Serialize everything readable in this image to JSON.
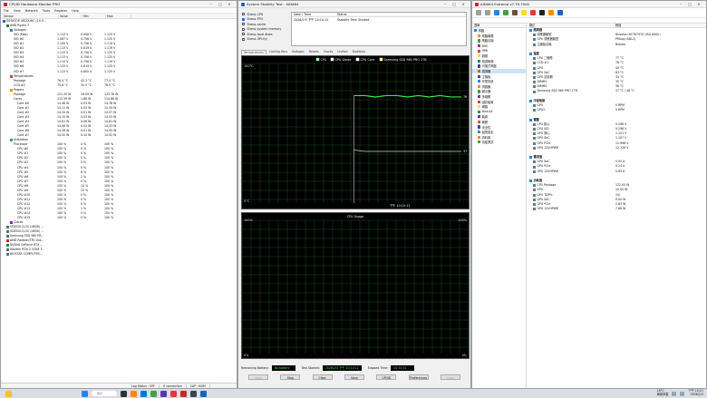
{
  "hwmonitor": {
    "title": "CPUID Hardware Monitor PRO",
    "menu": [
      "File",
      "View",
      "Network",
      "Tools",
      "Register",
      "Help"
    ],
    "columns": [
      "Sensor",
      "Value",
      "Min",
      "Max"
    ],
    "rows": [
      {
        "indent": 0,
        "label": "DESKTOP-4RCDUHC (10.0...",
        "v": "",
        "mn": "",
        "mx": "",
        "icon": "#2b6cb0"
      },
      {
        "indent": 1,
        "label": "AMD Ryzen 7",
        "v": "",
        "mn": "",
        "mx": "",
        "icon": "#2e7d32"
      },
      {
        "indent": 2,
        "label": "Voltages",
        "v": "",
        "mn": "",
        "mx": "",
        "icon": "#1e88e5"
      },
      {
        "indent": 3,
        "label": "VID (Max)",
        "v": "1.113 V",
        "mn": "0.956 V",
        "mx": "1.125 V",
        "icon": ""
      },
      {
        "indent": 3,
        "label": "VID #0",
        "v": "1.087 V",
        "mn": "0.756 V",
        "mx": "1.125 V",
        "icon": ""
      },
      {
        "indent": 3,
        "label": "VID #1",
        "v": "1.100 V",
        "mn": "0.756 V",
        "mx": "1.119 V",
        "icon": ""
      },
      {
        "indent": 3,
        "label": "VID #2",
        "v": "1.113 V",
        "mn": "0.819 V",
        "mx": "1.119 V",
        "icon": ""
      },
      {
        "indent": 3,
        "label": "VID #3",
        "v": "1.113 V",
        "mn": "0.756 V",
        "mx": "1.125 V",
        "icon": ""
      },
      {
        "indent": 3,
        "label": "VID #4",
        "v": "1.113 V",
        "mn": "0.756 V",
        "mx": "1.125 V",
        "icon": ""
      },
      {
        "indent": 3,
        "label": "VID #5",
        "v": "1.113 V",
        "mn": "0.756 V",
        "mx": "1.119 V",
        "icon": ""
      },
      {
        "indent": 3,
        "label": "VID #6",
        "v": "1.125 V",
        "mn": "0.819 V",
        "mx": "1.125 V",
        "icon": ""
      },
      {
        "indent": 3,
        "label": "VID #7",
        "v": "1.113 V",
        "mn": "0.800 V",
        "mx": "1.125 V",
        "icon": ""
      },
      {
        "indent": 2,
        "label": "Temperatures",
        "v": "",
        "mn": "",
        "mx": "",
        "icon": "#e53935"
      },
      {
        "indent": 3,
        "label": "Package",
        "v": "76.4 °C",
        "mn": "42.3 °C",
        "mx": "77.4 °C",
        "icon": ""
      },
      {
        "indent": 3,
        "label": "CCD #0",
        "v": "75.8 °C",
        "mn": "32.0 °C",
        "mx": "78.5 °C",
        "icon": ""
      },
      {
        "indent": 2,
        "label": "Powers",
        "v": "",
        "mn": "",
        "mx": "",
        "icon": "#fb8c00"
      },
      {
        "indent": 3,
        "label": "Package",
        "v": "121.20 W",
        "mn": "19.09 W",
        "mx": "123.78 W",
        "icon": ""
      },
      {
        "indent": 3,
        "label": "Cores",
        "v": "112.59 W",
        "mn": "1.68 W",
        "mx": "114.68 W",
        "icon": ""
      },
      {
        "indent": 4,
        "label": "Core #0",
        "v": "14.48 W",
        "mn": "0.03 W",
        "mx": "14.78 W",
        "icon": ""
      },
      {
        "indent": 4,
        "label": "Core #1",
        "v": "14.11 W",
        "mn": "0.02 W",
        "mx": "14.34 W",
        "icon": ""
      },
      {
        "indent": 4,
        "label": "Core #2",
        "v": "14.34 W",
        "mn": "0.01 W",
        "mx": "14.57 W",
        "icon": ""
      },
      {
        "indent": 4,
        "label": "Core #3",
        "v": "14.15 W",
        "mn": "0.03 W",
        "mx": "14.53 W",
        "icon": ""
      },
      {
        "indent": 4,
        "label": "Core #4",
        "v": "14.61 W",
        "mn": "0.06 W",
        "mx": "14.81 W",
        "icon": ""
      },
      {
        "indent": 4,
        "label": "Core #5",
        "v": "14.06 W",
        "mn": "0.02 W",
        "mx": "14.33 W",
        "icon": ""
      },
      {
        "indent": 4,
        "label": "Core #6",
        "v": "14.28 W",
        "mn": "0.01 W",
        "mx": "14.55 W",
        "icon": ""
      },
      {
        "indent": 4,
        "label": "Core #7",
        "v": "14.52 W",
        "mn": "0.10 W",
        "mx": "14.92 W",
        "icon": ""
      },
      {
        "indent": 2,
        "label": "Utilization",
        "v": "",
        "mn": "",
        "mx": "",
        "icon": "#43a047"
      },
      {
        "indent": 3,
        "label": "Processor",
        "v": "100 %",
        "mn": "4 %",
        "mx": "100 %",
        "icon": ""
      },
      {
        "indent": 4,
        "label": "CPU #0",
        "v": "100 %",
        "mn": "0 %",
        "mx": "100 %",
        "icon": ""
      },
      {
        "indent": 4,
        "label": "CPU #1",
        "v": "100 %",
        "mn": "0 %",
        "mx": "100 %",
        "icon": ""
      },
      {
        "indent": 4,
        "label": "CPU #2",
        "v": "100 %",
        "mn": "0 %",
        "mx": "100 %",
        "icon": ""
      },
      {
        "indent": 4,
        "label": "CPU #3",
        "v": "100 %",
        "mn": "0 %",
        "mx": "100 %",
        "icon": ""
      },
      {
        "indent": 4,
        "label": "CPU #4",
        "v": "100 %",
        "mn": "0 %",
        "mx": "100 %",
        "icon": ""
      },
      {
        "indent": 4,
        "label": "CPU #5",
        "v": "100 %",
        "mn": "6 %",
        "mx": "100 %",
        "icon": ""
      },
      {
        "indent": 4,
        "label": "CPU #6",
        "v": "100 %",
        "mn": "2 %",
        "mx": "100 %",
        "icon": ""
      },
      {
        "indent": 4,
        "label": "CPU #7",
        "v": "100 %",
        "mn": "0 %",
        "mx": "100 %",
        "icon": ""
      },
      {
        "indent": 4,
        "label": "CPU #8",
        "v": "100 %",
        "mn": "14 %",
        "mx": "100 %",
        "icon": ""
      },
      {
        "indent": 4,
        "label": "CPU #9",
        "v": "100 %",
        "mn": "15 %",
        "mx": "100 %",
        "icon": ""
      },
      {
        "indent": 4,
        "label": "CPU #10",
        "v": "100 %",
        "mn": "0 %",
        "mx": "100 %",
        "icon": ""
      },
      {
        "indent": 4,
        "label": "CPU #11",
        "v": "100 %",
        "mn": "0 %",
        "mx": "100 %",
        "icon": ""
      },
      {
        "indent": 4,
        "label": "CPU #12",
        "v": "100 %",
        "mn": "0 %",
        "mx": "100 %",
        "icon": ""
      },
      {
        "indent": 4,
        "label": "CPU #13",
        "v": "100 %",
        "mn": "1 %",
        "mx": "100 %",
        "icon": ""
      },
      {
        "indent": 4,
        "label": "CPU #14",
        "v": "100 %",
        "mn": "0 %",
        "mx": "100 %",
        "icon": ""
      },
      {
        "indent": 4,
        "label": "CPU #15",
        "v": "100 %",
        "mn": "0 %",
        "mx": "100 %",
        "icon": ""
      },
      {
        "indent": 2,
        "label": "Clocks",
        "v": "",
        "mn": "",
        "mx": "",
        "icon": "#8e24aa"
      },
      {
        "indent": 1,
        "label": "UDESIII CL34 (16GB) ...",
        "v": "",
        "mn": "",
        "mx": "",
        "icon": "#546e7a"
      },
      {
        "indent": 1,
        "label": "UDESIII CL34 (16GB) ...",
        "v": "",
        "mn": "",
        "mx": "",
        "icon": "#546e7a"
      },
      {
        "indent": 1,
        "label": "Samsung SSD 960 PR...",
        "v": "",
        "mn": "",
        "mx": "",
        "icon": "#546e7a"
      },
      {
        "indent": 1,
        "label": "AMD Radeon(TM) Gra...",
        "v": "",
        "mn": "",
        "mx": "",
        "icon": "#c62828"
      },
      {
        "indent": 1,
        "label": "NVIDIA GeForce RTX ...",
        "v": "",
        "mn": "",
        "mx": "",
        "icon": "#2e7d32"
      },
      {
        "indent": 1,
        "label": "Realtek PCIe 2.5GbE F...",
        "v": "",
        "mn": "",
        "mx": "",
        "icon": "#546e7a"
      },
      {
        "indent": 1,
        "label": "BIOSTAR COMPUTER...",
        "v": "",
        "mn": "",
        "mx": "",
        "icon": "#546e7a"
      }
    ],
    "status": [
      "Log Status : OFF",
      "0 connection",
      "CAP : NUM"
    ]
  },
  "stability": {
    "title": "System Stability Test - AIDA64",
    "checks": [
      {
        "label": "Stress CPU",
        "on": false
      },
      {
        "label": "Stress FPU",
        "on": true
      },
      {
        "label": "Stress cache",
        "on": false
      },
      {
        "label": "Stress system memory",
        "on": false
      },
      {
        "label": "Stress local disks",
        "on": false
      },
      {
        "label": "Stress GPU(s)",
        "on": false
      }
    ],
    "table_head": [
      "Date / Time",
      "Status"
    ],
    "table_row": [
      "2026/2/3 下午 10:10:12",
      "Stability Test: Started"
    ],
    "tabs": [
      "Temperatures",
      "Cooling Fans",
      "Voltages",
      "Powers",
      "Clocks",
      "Unified",
      "Statistics"
    ],
    "legend": [
      "CPU",
      "CPU Diode",
      "CPU Core",
      "Samsung SSD 960 PRO 1TB"
    ],
    "temp_top": "100°C",
    "temp_bottom": "0°C",
    "temp_time": "下午 10:10:12",
    "val_a": "76",
    "val_b": "37",
    "cpu_usage_title": "CPU Usage",
    "usage_top": "100%",
    "usage_bottom": "0%",
    "usage_top_r": "100%",
    "usage_bottom_r": "0%",
    "battery_label": "Remaining Battery:",
    "battery_value": "No battery",
    "started_label": "Test Started:",
    "started_value": "2026/2/3 下午 10:10:12",
    "elapsed_label": "Elapsed Time:",
    "elapsed_value": "00:10:31",
    "buttons": [
      "Start",
      "Stop",
      "Clear",
      "Save",
      "CPUID",
      "Preferences",
      "Close"
    ]
  },
  "aida": {
    "title": "AIDA64 Extreme v7.70.7500",
    "left_header": "選單",
    "tree": [
      "電腦",
      "電腦摘要",
      "電腦名稱",
      "DMI",
      "IPMI",
      "超頻",
      "電源管理",
      "可攜式電腦",
      "感測器",
      "主機板",
      "作業系統",
      "伺服器",
      "顯示器",
      "多媒體",
      "儲存裝置",
      "網路",
      "DirectX",
      "裝置",
      "軟體",
      "安全性",
      "組態設定",
      "資料庫",
      "效能測試"
    ],
    "selected_tree": 8,
    "right_header": [
      "欄位",
      "數值"
    ],
    "rows": [
      {
        "sec": true,
        "label": "感測器",
        "value": ""
      },
      {
        "sec": false,
        "label": "感應器類型",
        "value": "Nuvoton NCT6797D (ISA A00h)"
      },
      {
        "sec": false,
        "label": "GPU 感應器類型",
        "value": "PMLog (ADL2)"
      },
      {
        "sec": false,
        "label": "主機板名稱",
        "value": "Biostar"
      },
      {
        "sec": false,
        "label": "",
        "value": ""
      },
      {
        "sec": true,
        "label": "溫度",
        "value": ""
      },
      {
        "sec": false,
        "label": "CPU 二極體",
        "value": "77 °C"
      },
      {
        "sec": false,
        "label": "CCD #1",
        "value": "78 °C"
      },
      {
        "sec": false,
        "label": "GPU",
        "value": "49 °C"
      },
      {
        "sec": false,
        "label": "GPU SoC",
        "value": "63 °C"
      },
      {
        "sec": false,
        "label": "GPU 記憶體",
        "value": "34 °C"
      },
      {
        "sec": false,
        "label": "DIMM1",
        "value": "35 °C"
      },
      {
        "sec": false,
        "label": "DIMM2",
        "value": "36 °C"
      },
      {
        "sec": false,
        "label": "Samsung SSD 960 PRO 1TB",
        "value": "37 °C / 48 °C"
      },
      {
        "sec": false,
        "label": "",
        "value": ""
      },
      {
        "sec": true,
        "label": "冷卻風扇",
        "value": ""
      },
      {
        "sec": false,
        "label": "GPU",
        "value": "0 RPM"
      },
      {
        "sec": false,
        "label": "GPU2",
        "value": "0 RPM"
      },
      {
        "sec": false,
        "label": "",
        "value": ""
      },
      {
        "sec": true,
        "label": "電壓",
        "value": ""
      },
      {
        "sec": false,
        "label": "CPU 核心",
        "value": "0.298 V"
      },
      {
        "sec": false,
        "label": "CPU VID",
        "value": "0.298 V"
      },
      {
        "sec": false,
        "label": "GPU 核心",
        "value": "1.121 V"
      },
      {
        "sec": false,
        "label": "GPU SoC",
        "value": "1.107 V"
      },
      {
        "sec": false,
        "label": "GPU PCIe",
        "value": "11.996 V"
      },
      {
        "sec": false,
        "label": "GPU 12VHPWR",
        "value": "12.126 V"
      },
      {
        "sec": false,
        "label": "",
        "value": ""
      },
      {
        "sec": true,
        "label": "電流值",
        "value": ""
      },
      {
        "sec": false,
        "label": "GPU SoC",
        "value": "0.00 A"
      },
      {
        "sec": false,
        "label": "GPU PCIe",
        "value": "0.24 A"
      },
      {
        "sec": false,
        "label": "GPU 12VHPWR",
        "value": "0.63 A"
      },
      {
        "sec": false,
        "label": "",
        "value": ""
      },
      {
        "sec": true,
        "label": "功耗值",
        "value": ""
      },
      {
        "sec": false,
        "label": "CPU Package",
        "value": "122.05 W"
      },
      {
        "sec": false,
        "label": "GPU",
        "value": "10.00 W"
      },
      {
        "sec": false,
        "label": "GPU TDP%",
        "value": "2%"
      },
      {
        "sec": false,
        "label": "GPU SoC",
        "value": "0.00 W"
      },
      {
        "sec": false,
        "label": "GPU PCIe",
        "value": "2.83 W"
      },
      {
        "sec": false,
        "label": "GPU 12VHPWR",
        "value": "7.66 W"
      }
    ]
  },
  "taskbar": {
    "search_placeholder": "搜尋",
    "weather": "18°C",
    "weather_sub": "局部多雲",
    "time": "下午 10:21",
    "date": "2026/2/3"
  },
  "chart_data": [
    {
      "type": "line",
      "title": "",
      "series": [
        {
          "name": "CPU",
          "values": [
            null,
            null,
            null,
            null,
            null,
            null,
            null,
            null,
            null,
            null,
            77,
            77,
            76,
            77,
            77,
            76,
            77,
            76,
            77,
            76,
            76
          ]
        },
        {
          "name": "Samsung SSD 960 PRO 1TB",
          "values": [
            null,
            null,
            null,
            null,
            null,
            null,
            null,
            null,
            null,
            null,
            38,
            37,
            37,
            37,
            37,
            37,
            37,
            37,
            37,
            37,
            37
          ]
        }
      ],
      "ylim": [
        0,
        100
      ]
    },
    {
      "type": "line",
      "title": "CPU Usage",
      "series": [
        {
          "values": []
        }
      ],
      "ylim": [
        0,
        100
      ]
    }
  ]
}
